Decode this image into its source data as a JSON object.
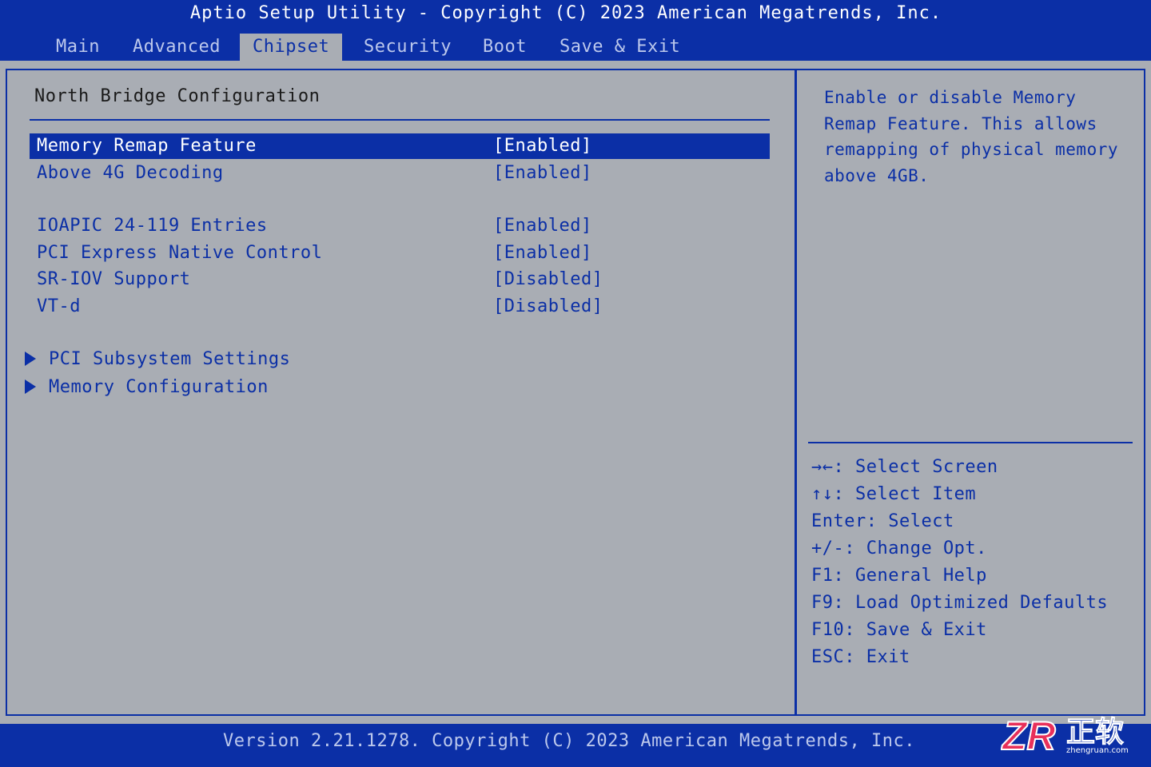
{
  "title": "Aptio Setup Utility - Copyright (C) 2023 American Megatrends, Inc.",
  "tabs": [
    {
      "label": "Main"
    },
    {
      "label": "Advanced"
    },
    {
      "label": "Chipset"
    },
    {
      "label": "Security"
    },
    {
      "label": "Boot"
    },
    {
      "label": "Save & Exit"
    }
  ],
  "active_tab": "Chipset",
  "section_title": "North Bridge Configuration",
  "settings": [
    {
      "label": "Memory Remap Feature",
      "value": "[Enabled]"
    },
    {
      "label": "Above 4G Decoding",
      "value": "[Enabled]"
    },
    {
      "label": "IOAPIC 24-119 Entries",
      "value": "[Enabled]"
    },
    {
      "label": "PCI Express Native Control",
      "value": "[Enabled]"
    },
    {
      "label": "SR-IOV Support",
      "value": "[Disabled]"
    },
    {
      "label": "VT-d",
      "value": "[Disabled]"
    }
  ],
  "selected_setting": "Memory Remap Feature",
  "submenus": [
    {
      "label": "PCI Subsystem Settings"
    },
    {
      "label": "Memory Configuration"
    }
  ],
  "help_text": "Enable or disable Memory Remap Feature. This allows remapping of physical memory above 4GB.",
  "key_hints": [
    {
      "label": "→←: Select Screen"
    },
    {
      "label": "↑↓: Select Item"
    },
    {
      "label": "Enter: Select"
    },
    {
      "label": "+/-: Change Opt."
    },
    {
      "label": "F1: General Help"
    },
    {
      "label": "F9: Load Optimized Defaults"
    },
    {
      "label": "F10: Save & Exit"
    },
    {
      "label": "ESC: Exit"
    }
  ],
  "footer": "Version 2.21.1278. Copyright (C) 2023 American Megatrends, Inc.",
  "watermark": {
    "text": "正软",
    "url_text": "zhengruan.com"
  },
  "colors": {
    "bios_blue": "#0b2fa6",
    "panel_gray": "#a9adb4",
    "inactive_tab": "#bcc8ec",
    "logo_red": "#e8305a"
  }
}
